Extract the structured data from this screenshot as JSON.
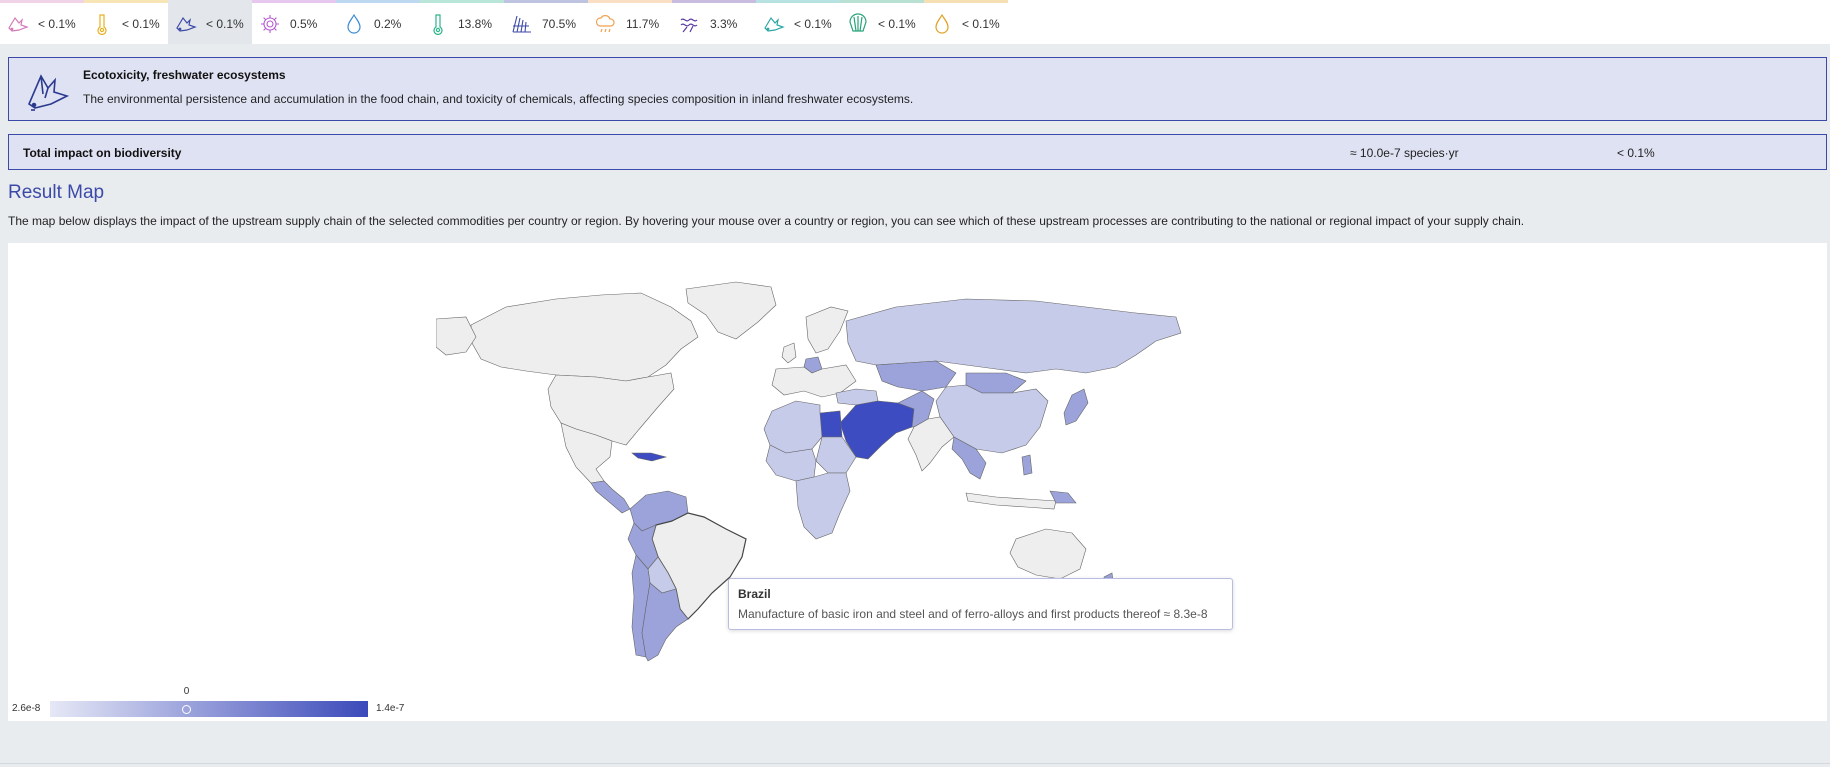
{
  "tabs": [
    {
      "icon": "fish-icon",
      "value": "< 0.1%",
      "color": "#d47ab8",
      "active": false
    },
    {
      "icon": "thermometer-icon",
      "value": "< 0.1%",
      "color": "#e8b020",
      "active": false
    },
    {
      "icon": "fish-icon",
      "value": "< 0.1%",
      "color": "#3b4aa8",
      "active": true
    },
    {
      "icon": "virus-icon",
      "value": "0.5%",
      "color": "#b35bd0",
      "active": false
    },
    {
      "icon": "droplet-icon",
      "value": "0.2%",
      "color": "#3c8bd6",
      "active": false
    },
    {
      "icon": "thermometer-icon",
      "value": "13.8%",
      "color": "#2db58a",
      "active": false
    },
    {
      "icon": "field-icon",
      "value": "70.5%",
      "color": "#3b4aa8",
      "active": false
    },
    {
      "icon": "cloud-rain-icon",
      "value": "11.7%",
      "color": "#f0a050",
      "active": false
    },
    {
      "icon": "wave-icon",
      "value": "3.3%",
      "color": "#5b3aa0",
      "active": false
    },
    {
      "icon": "fish-icon",
      "value": "< 0.1%",
      "color": "#2aa6a6",
      "active": false
    },
    {
      "icon": "shell-icon",
      "value": "< 0.1%",
      "color": "#2aa37a",
      "active": false
    },
    {
      "icon": "droplet-icon",
      "value": "< 0.1%",
      "color": "#e0a020",
      "active": false
    }
  ],
  "info": {
    "title": "Ecotoxicity, freshwater ecosystems",
    "description": "The environmental persistence and accumulation in the food chain, and toxicity of chemicals, affecting species composition in inland freshwater ecosystems."
  },
  "total": {
    "label": "Total impact on biodiversity",
    "amount": "≈ 10.0e-7 species·yr",
    "percent": "< 0.1%"
  },
  "result_map": {
    "title": "Result Map",
    "description": "The map below displays the impact of the upstream supply chain of the selected commodities per country or region. By hovering your mouse over a country or region, you can see which of these upstream processes are contributing to the national or regional impact of your supply chain.",
    "tooltip": {
      "country": "Brazil",
      "text": "Manufacture of basic iron and steel and of ferro-alloys and first products thereof ≈ 8.3e-8"
    },
    "legend": {
      "min": "2.6e-8",
      "max": "1.4e-7",
      "marker_label": "0",
      "marker_value": 0.43
    },
    "colors": {
      "none": "#eeeeee",
      "low": "#c6cbe9",
      "mid": "#9ba3da",
      "high": "#3d4cc0"
    }
  }
}
